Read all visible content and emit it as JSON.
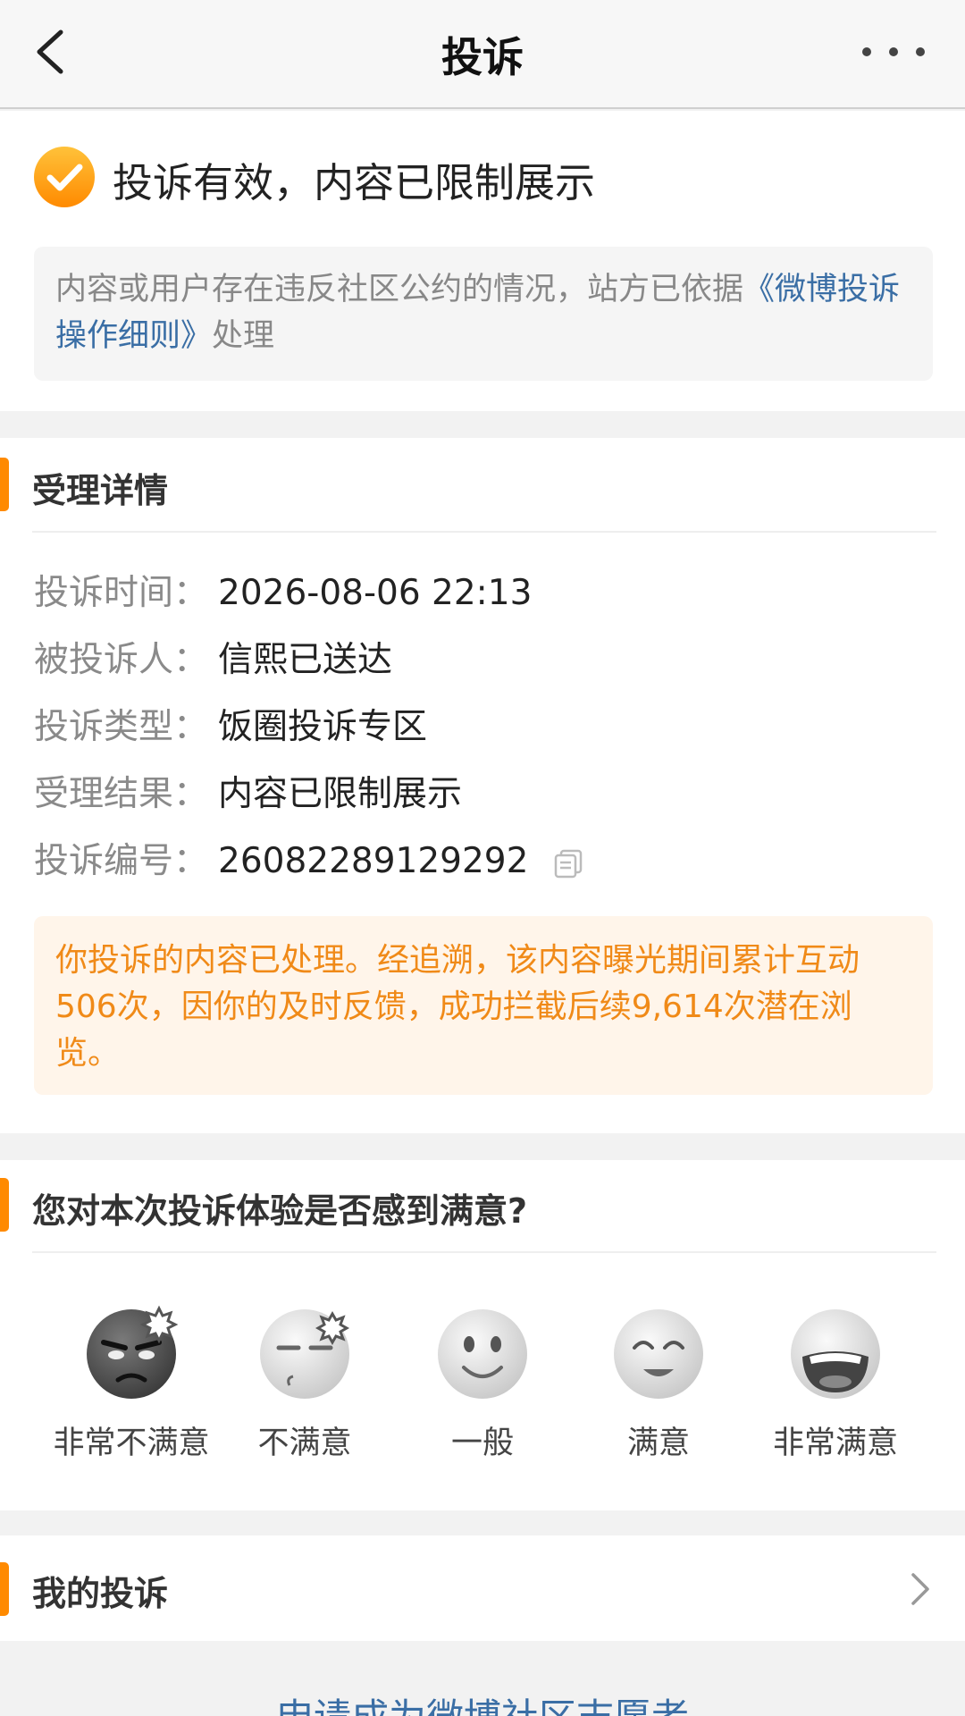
{
  "header": {
    "title": "投诉",
    "back_icon": "chevron-left-icon",
    "more_icon": "more-dots-icon"
  },
  "result": {
    "status_icon": "check-circle-icon",
    "title": "投诉有效，内容已限制展示",
    "notice_prefix": "内容或用户存在违反社区公约的情况，站方已依据",
    "notice_link": "《微博投诉操作细则》",
    "notice_suffix": "处理"
  },
  "details": {
    "section_title": "受理详情",
    "rows": [
      {
        "label": "投诉时间：",
        "value": "2026-08-06 22:13"
      },
      {
        "label": "被投诉人：",
        "value": "信熙已送达"
      },
      {
        "label": "投诉类型：",
        "value": "饭圈投诉专区"
      },
      {
        "label": "受理结果：",
        "value": "内容已限制展示"
      },
      {
        "label": "投诉编号：",
        "value": "26082289129292"
      }
    ],
    "copy_icon": "copy-icon",
    "impact_text": "你投诉的内容已处理。经追溯，该内容曝光期间累计互动506次，因你的及时反馈，成功拦截后续9,614次潜在浏览。"
  },
  "satisfaction": {
    "question": "您对本次投诉体验是否感到满意?",
    "options": [
      {
        "label": "非常不满意",
        "icon": "very-angry-face-icon"
      },
      {
        "label": "不满意",
        "icon": "annoyed-face-icon"
      },
      {
        "label": "一般",
        "icon": "neutral-smile-face-icon"
      },
      {
        "label": "满意",
        "icon": "happy-face-icon"
      },
      {
        "label": "非常满意",
        "icon": "laughing-face-icon"
      }
    ]
  },
  "my_complaints": {
    "label": "我的投诉",
    "icon": "chevron-right-icon"
  },
  "footer": {
    "link_text": "申请成为微博社区志愿者"
  },
  "colors": {
    "accent_orange": "#ff8a00",
    "link_blue": "#3a6ea5",
    "impact_text": "#f08a18",
    "impact_bg": "#fff5ea"
  }
}
